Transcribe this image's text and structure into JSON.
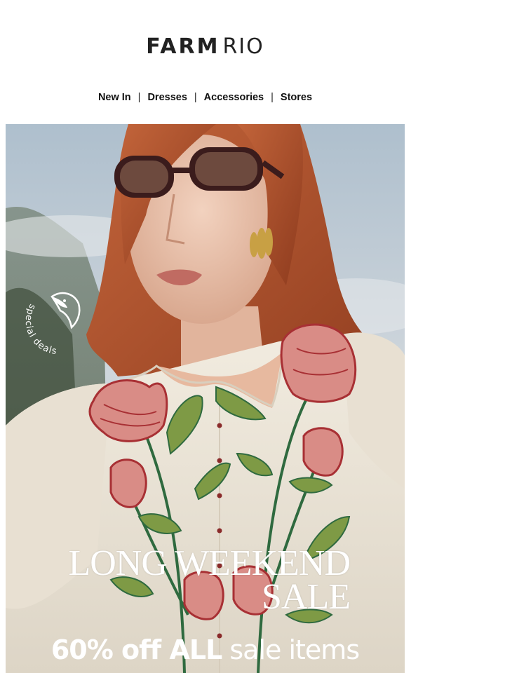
{
  "brand": {
    "logo_part1": "FARM",
    "logo_part2": "RIO"
  },
  "nav": {
    "items": [
      {
        "label": "New In"
      },
      {
        "label": "Dresses"
      },
      {
        "label": "Accessories"
      },
      {
        "label": "Stores"
      }
    ],
    "separator": "|"
  },
  "hero": {
    "badge_text": "special deals",
    "headline_line1": "LONG WEEKEND",
    "headline_line2": "SALE",
    "offer_bold": "60% off ALL",
    "offer_rest": "sale items"
  },
  "colors": {
    "sky": "#b9c7d3",
    "hair": "#b5532c",
    "blouse": "#ede6d8",
    "flower_red": "#b63a3c",
    "leaf_green": "#7e9a45",
    "stem_green": "#2f6a3f",
    "text_dark": "#111111"
  }
}
